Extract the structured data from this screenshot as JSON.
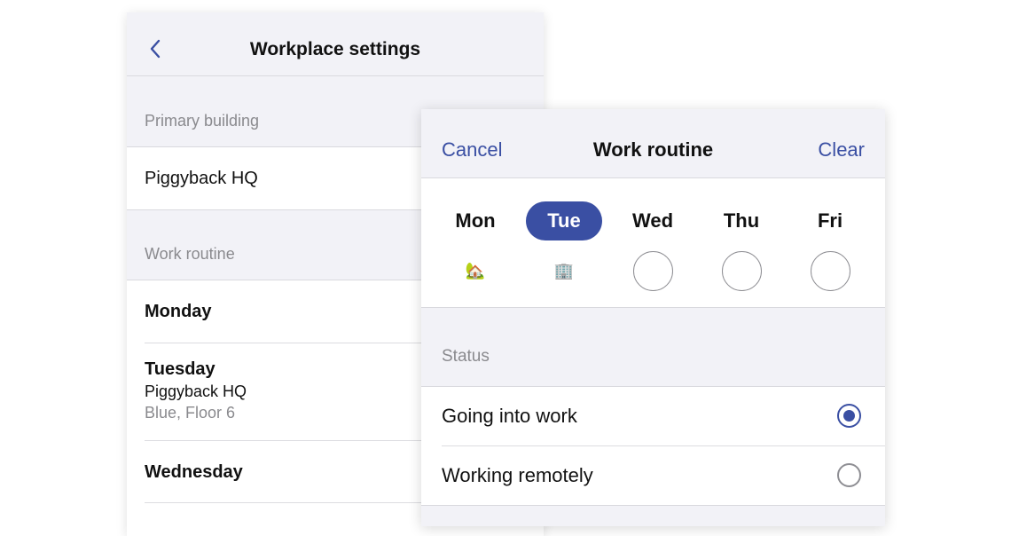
{
  "settings": {
    "title": "Workplace settings",
    "back_icon": "chevron-left-icon",
    "primary_building_label": "Primary building",
    "primary_building_value": "Piggyback HQ",
    "work_routine_label": "Work routine",
    "days": [
      {
        "name": "Monday"
      },
      {
        "name": "Tuesday",
        "building": "Piggyback HQ",
        "location": "Blue, Floor 6"
      },
      {
        "name": "Wednesday"
      }
    ]
  },
  "routine_modal": {
    "title": "Work routine",
    "cancel_label": "Cancel",
    "clear_label": "Clear",
    "days": [
      {
        "label": "Mon",
        "selected": false,
        "status_icon": "🏡",
        "status": "remote"
      },
      {
        "label": "Tue",
        "selected": true,
        "status_icon": "🏢",
        "status": "office"
      },
      {
        "label": "Wed",
        "selected": false,
        "status_icon": "",
        "status": "unset"
      },
      {
        "label": "Thu",
        "selected": false,
        "status_icon": "",
        "status": "unset"
      },
      {
        "label": "Fri",
        "selected": false,
        "status_icon": "",
        "status": "unset"
      }
    ],
    "status_label": "Status",
    "options": [
      {
        "label": "Going into work",
        "checked": true
      },
      {
        "label": "Working remotely",
        "checked": false
      }
    ]
  },
  "colors": {
    "accent": "#3a4fa3",
    "background": "#f2f2f7",
    "secondary_text": "#8a8a8e"
  }
}
